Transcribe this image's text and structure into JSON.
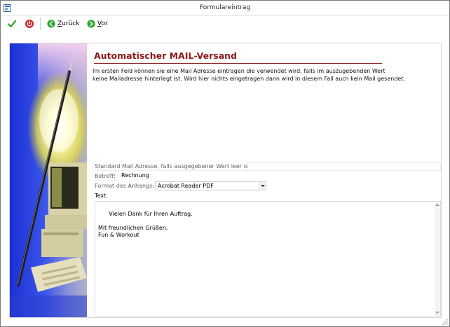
{
  "window": {
    "title": "Formulareintrag"
  },
  "toolbar": {
    "ok_icon": "check-icon",
    "cancel_icon": "power-icon",
    "back_label_prefix": "",
    "back_label_key": "Z",
    "back_label_rest": "urück",
    "forward_label_key": "V",
    "forward_label_rest": "or",
    "colors": {
      "check": "#2ea82e",
      "power": "#cc2222",
      "nav": "#2ea82e"
    }
  },
  "content": {
    "heading": "Automatischer MAIL-Versand",
    "heading_color": "#8b1a1a",
    "description_line1": "Im ersten Feld können sie eine Mail Adresse eintragen die verwendet wird, falls im auszugebenden Wert",
    "description_line2": "keine Mailadresse hinterlegt ist. Wird hier nichts eingetragen dann wird in diesem Fall auch kein Mail gesendet."
  },
  "form": {
    "standard_mail": {
      "label": "Standard Mail Adresse, falls ausgegebener Wert leer ist:",
      "value": ""
    },
    "betreff": {
      "label": "Betreff:",
      "value": "Rechnung"
    },
    "format": {
      "label": "Format des Anhangs:",
      "value": "Acrobat Reader PDF"
    },
    "text": {
      "label": "Text:",
      "value": "Vielen Dank für Ihren Auftrag.\n\nMit freundlichen Grüßen,\nFun & Workout"
    }
  }
}
